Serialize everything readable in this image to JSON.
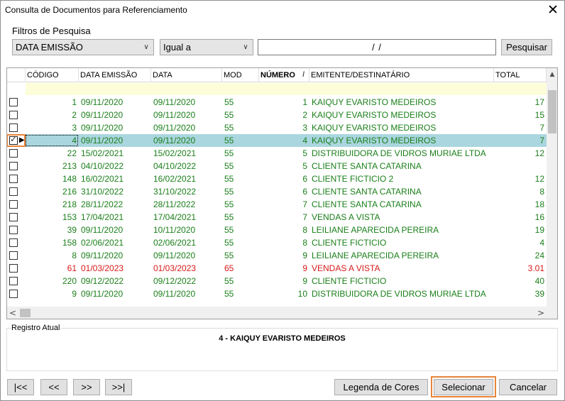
{
  "window": {
    "title": "Consulta de Documentos para Referenciamento",
    "close_symbol": "✕"
  },
  "filters": {
    "title": "Filtros de Pesquisa",
    "field_select": "DATA EMISSÃO",
    "operator_select": "Igual a",
    "value_input": "/ /",
    "search_button": "Pesquisar"
  },
  "grid": {
    "columns": [
      "CÓDIGO",
      "DATA EMISSÃO",
      "DATA",
      "MOD",
      "NÚMERO",
      "EMITENTE/DESTINATÁRIO",
      "TOTAL"
    ],
    "sorted_column": "NÚMERO",
    "sort_indicator": "/",
    "rows": [
      {
        "codigo": "1",
        "data_emissao": "09/11/2020",
        "data": "09/11/2020",
        "mod": "55",
        "numero": "1",
        "emitente": "KAIQUY EVARISTO MEDEIROS",
        "total": "17",
        "checked": false,
        "color": "green"
      },
      {
        "codigo": "2",
        "data_emissao": "09/11/2020",
        "data": "09/11/2020",
        "mod": "55",
        "numero": "2",
        "emitente": "KAIQUY EVARISTO MEDEIROS",
        "total": "15",
        "checked": false,
        "color": "green"
      },
      {
        "codigo": "3",
        "data_emissao": "09/11/2020",
        "data": "09/11/2020",
        "mod": "55",
        "numero": "3",
        "emitente": "KAIQUY EVARISTO MEDEIROS",
        "total": "7",
        "checked": false,
        "color": "green"
      },
      {
        "codigo": "4",
        "data_emissao": "09/11/2020",
        "data": "09/11/2020",
        "mod": "55",
        "numero": "4",
        "emitente": "KAIQUY EVARISTO MEDEIROS",
        "total": "7",
        "checked": true,
        "color": "green",
        "selected": true
      },
      {
        "codigo": "22",
        "data_emissao": "15/02/2021",
        "data": "15/02/2021",
        "mod": "55",
        "numero": "5",
        "emitente": "DISTRIBUIDORA DE VIDROS MURIAE LTDA",
        "total": "12",
        "checked": false,
        "color": "green"
      },
      {
        "codigo": "213",
        "data_emissao": "04/10/2022",
        "data": "04/10/2022",
        "mod": "55",
        "numero": "5",
        "emitente": "CLIENTE SANTA CATARINA",
        "total": "",
        "checked": false,
        "color": "green"
      },
      {
        "codigo": "148",
        "data_emissao": "16/02/2021",
        "data": "16/02/2021",
        "mod": "55",
        "numero": "6",
        "emitente": "CLIENTE FICTICIO 2",
        "total": "12",
        "checked": false,
        "color": "green"
      },
      {
        "codigo": "216",
        "data_emissao": "31/10/2022",
        "data": "31/10/2022",
        "mod": "55",
        "numero": "6",
        "emitente": "CLIENTE SANTA CATARINA",
        "total": "8",
        "checked": false,
        "color": "green"
      },
      {
        "codigo": "218",
        "data_emissao": "28/11/2022",
        "data": "28/11/2022",
        "mod": "55",
        "numero": "7",
        "emitente": "CLIENTE SANTA CATARINA",
        "total": "18",
        "checked": false,
        "color": "green"
      },
      {
        "codigo": "153",
        "data_emissao": "17/04/2021",
        "data": "17/04/2021",
        "mod": "55",
        "numero": "7",
        "emitente": "VENDAS A VISTA",
        "total": "16",
        "checked": false,
        "color": "green"
      },
      {
        "codigo": "39",
        "data_emissao": "09/11/2020",
        "data": "10/11/2020",
        "mod": "55",
        "numero": "8",
        "emitente": "LEILIANE APARECIDA PEREIRA",
        "total": "19",
        "checked": false,
        "color": "green"
      },
      {
        "codigo": "158",
        "data_emissao": "02/06/2021",
        "data": "02/06/2021",
        "mod": "55",
        "numero": "8",
        "emitente": "CLIENTE FICTICIO",
        "total": "4",
        "checked": false,
        "color": "green"
      },
      {
        "codigo": "8",
        "data_emissao": "09/11/2020",
        "data": "09/11/2020",
        "mod": "55",
        "numero": "9",
        "emitente": "LEILIANE APARECIDA PEREIRA",
        "total": "24",
        "checked": false,
        "color": "green"
      },
      {
        "codigo": "61",
        "data_emissao": "01/03/2023",
        "data": "01/03/2023",
        "mod": "65",
        "numero": "9",
        "emitente": "VENDAS A VISTA",
        "total": "3.01",
        "checked": false,
        "color": "red"
      },
      {
        "codigo": "220",
        "data_emissao": "09/12/2022",
        "data": "09/12/2022",
        "mod": "55",
        "numero": "9",
        "emitente": "CLIENTE FICTICIO",
        "total": "40",
        "checked": false,
        "color": "green"
      },
      {
        "codigo": "9",
        "data_emissao": "09/11/2020",
        "data": "09/11/2020",
        "mod": "55",
        "numero": "10",
        "emitente": "DISTRIBUIDORA DE VIDROS MURIAE LTDA",
        "total": "39",
        "checked": false,
        "color": "green"
      }
    ],
    "scroll_left": "<",
    "scroll_right": ">",
    "scroll_up": "▲"
  },
  "current_record": {
    "label": "Registro Atual",
    "value": "4 - KAIQUY EVARISTO MEDEIROS"
  },
  "navigation": {
    "first": "|<<",
    "prev": "<<",
    "next": ">>",
    "last": ">>|"
  },
  "actions": {
    "legend": "Legenda de Cores",
    "select": "Selecionar",
    "cancel": "Cancelar"
  },
  "colors": {
    "green_text": "#1a7f1a",
    "red_text": "#d81a1a",
    "selected_row": "#aad6df",
    "filter_row": "#fdfed9",
    "highlight_outline": "#e8843a"
  }
}
